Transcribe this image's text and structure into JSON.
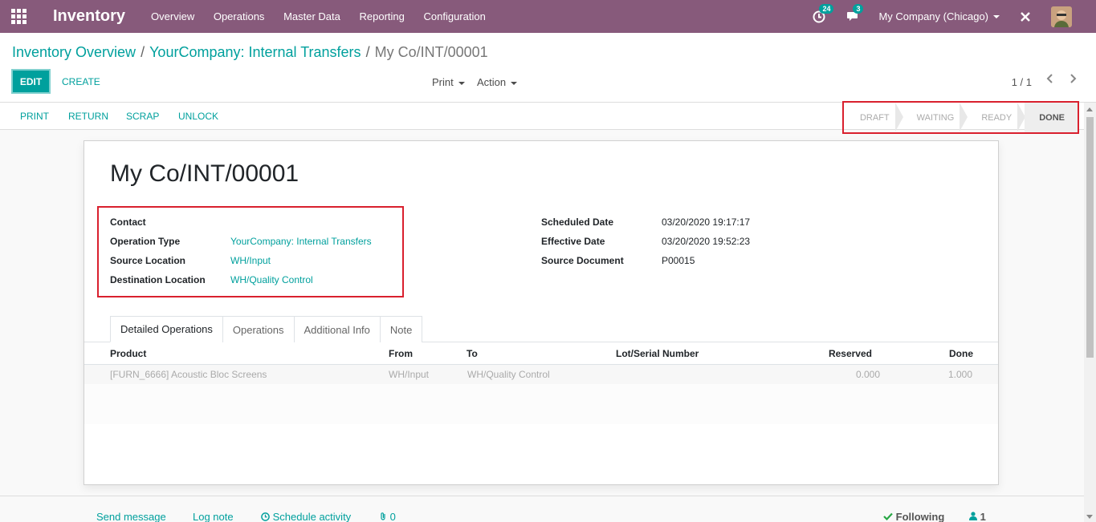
{
  "app": {
    "title": "Inventory"
  },
  "menu": [
    "Overview",
    "Operations",
    "Master Data",
    "Reporting",
    "Configuration"
  ],
  "nav": {
    "activity_count": "24",
    "message_count": "3",
    "company": "My Company (Chicago)"
  },
  "breadcrumb": {
    "item1": "Inventory Overview",
    "item2": "YourCompany: Internal Transfers",
    "current": "My Co/INT/00001"
  },
  "toolbar": {
    "edit": "EDIT",
    "create": "CREATE",
    "print": "Print",
    "action": "Action",
    "pager": "1 / 1"
  },
  "statusbar": {
    "print": "PRINT",
    "return": "RETURN",
    "scrap": "SCRAP",
    "unlock": "UNLOCK",
    "stages": [
      "DRAFT",
      "WAITING",
      "READY",
      "DONE"
    ],
    "active_stage": "DONE"
  },
  "record": {
    "name": "My Co/INT/00001",
    "left": [
      {
        "label": "Contact",
        "value": ""
      },
      {
        "label": "Operation Type",
        "value": "YourCompany: Internal Transfers"
      },
      {
        "label": "Source Location",
        "value": "WH/Input"
      },
      {
        "label": "Destination Location",
        "value": "WH/Quality Control"
      }
    ],
    "right": [
      {
        "label": "Scheduled Date",
        "value": "03/20/2020 19:17:17"
      },
      {
        "label": "Effective Date",
        "value": "03/20/2020 19:52:23"
      },
      {
        "label": "Source Document",
        "value": "P00015"
      }
    ]
  },
  "tabs": [
    "Detailed Operations",
    "Operations",
    "Additional Info",
    "Note"
  ],
  "table": {
    "headers": [
      "Product",
      "From",
      "To",
      "Lot/Serial Number",
      "Reserved",
      "Done"
    ],
    "rows": [
      [
        "[FURN_6666] Acoustic Bloc Screens",
        "WH/Input",
        "WH/Quality Control",
        "",
        "0.000",
        "1.000"
      ]
    ]
  },
  "chatter": {
    "send": "Send message",
    "log": "Log note",
    "schedule": "Schedule activity",
    "attachments": "0",
    "following": "Following",
    "followers": "1"
  },
  "colors": {
    "brand": "#875a7b",
    "accent": "#00a09d",
    "highlight": "#d9202e"
  }
}
